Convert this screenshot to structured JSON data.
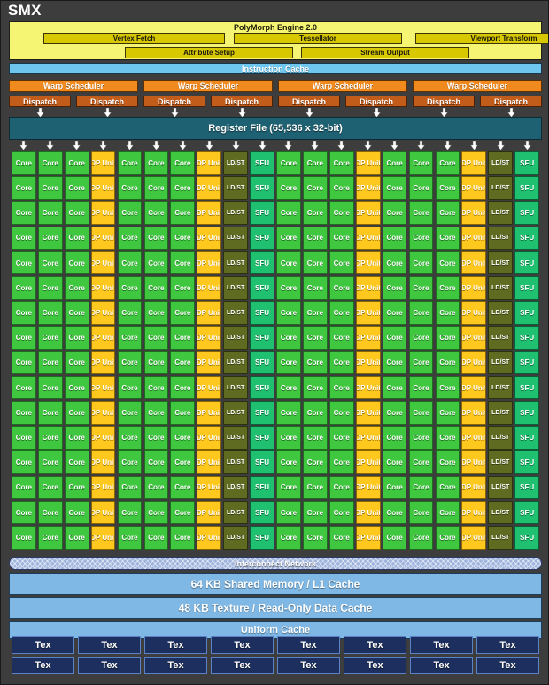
{
  "diagram": {
    "title": "SMX",
    "colors": {
      "chassis": "#3d3d3d",
      "polymorph_bg": "#f6f473",
      "polymorph_cell": "#d8c800",
      "instruction_cache": "#6ec6ef",
      "warp_scheduler": "#f18a1e",
      "dispatch": "#c25c1b",
      "register_file": "#1e6173",
      "core": "#3fc73f",
      "dp_unit": "#ffc81e",
      "ldst": "#5e6b20",
      "sfu": "#1fc070",
      "interconnect": "#9fb4dd",
      "cache_bar": "#7fb8e4",
      "tex": "#1c2f5e"
    }
  },
  "polymorph": {
    "title": "PolyMorph Engine 2.0",
    "row1": [
      "Vertex Fetch",
      "Tessellator",
      "Viewport Transform"
    ],
    "row2": [
      "Attribute Setup",
      "Stream Output"
    ]
  },
  "instruction_cache": {
    "label": "Instruction Cache"
  },
  "schedulers": {
    "warp_label": "Warp Scheduler",
    "warp_count": 4,
    "dispatch_label": "Dispatch",
    "dispatch_count": 8
  },
  "register_file": {
    "label": "Register File (65,536 x 32-bit)",
    "entries": 65536,
    "width_bits": 32
  },
  "core_grid": {
    "rows": 16,
    "columns": 20,
    "column_pattern": [
      "Core",
      "Core",
      "Core",
      "DP Unit",
      "Core",
      "Core",
      "Core",
      "DP Unit",
      "LD/ST",
      "SFU",
      "Core",
      "Core",
      "Core",
      "DP Unit",
      "Core",
      "Core",
      "Core",
      "DP Unit",
      "LD/ST",
      "SFU"
    ],
    "labels": {
      "core": "Core",
      "dp": "DP Unit",
      "ldst": "LD/ST",
      "sfu": "SFU"
    },
    "totals": {
      "cores": 192,
      "dp_units": 64,
      "ldst_units": 32,
      "sfu_units": 32
    }
  },
  "interconnect": {
    "label": "Interconnect Network"
  },
  "caches": [
    {
      "label": "64 KB Shared Memory / L1 Cache",
      "size": "big"
    },
    {
      "label": "48 KB Texture / Read-Only Data Cache",
      "size": "big"
    },
    {
      "label": "Uniform Cache",
      "size": "small"
    }
  ],
  "texture_units": {
    "label": "Tex",
    "rows": 2,
    "columns": 8
  }
}
